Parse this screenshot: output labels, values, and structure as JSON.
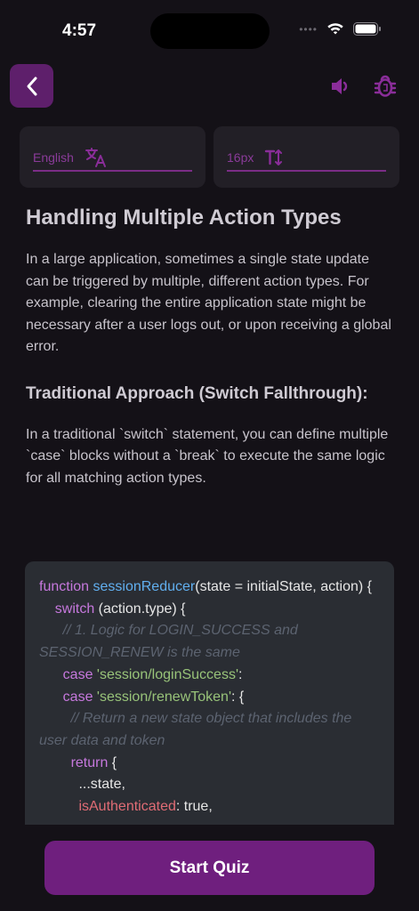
{
  "status": {
    "time": "4:57"
  },
  "colors": {
    "accent": "#6f1f7e",
    "background": "#141117",
    "code_bg": "#2a2d33"
  },
  "icons": {
    "back": "chevron-left-icon",
    "speaker": "speaker-icon",
    "bug": "bug-icon",
    "translate": "translate-icon",
    "font_size": "text-size-icon"
  },
  "settings": {
    "language": "English",
    "font_size": "16px"
  },
  "article": {
    "title": "Handling Multiple Action Types",
    "intro": "In a large application, sometimes a single state update can be triggered by multiple, different action types. For example, clearing the entire application state might be necessary after a user logs out, or upon receiving a global error.",
    "section_title": "Traditional Approach (Switch Fallthrough):",
    "section_text": "In a traditional `switch` statement, you can define multiple `case` blocks without a `break` to execute the same logic for all matching action types."
  },
  "code": {
    "l1_kw": "function",
    "l1_fn": "sessionReducer",
    "l1_rest": "(state = initialState, action) {",
    "l2_kw": "switch",
    "l2_rest": " (action.type) {",
    "l3_cm": "// 1. Logic for LOGIN_SUCCESS and SESSION_RENEW is the same",
    "l4_kw": "case",
    "l4_str": "'session/loginSuccess'",
    "l4_rest": ":",
    "l5_kw": "case",
    "l5_str": "'session/renewToken'",
    "l5_rest": ": {",
    "l6_cm": "// Return a new state object that includes the user data and token",
    "l7_kw": "return",
    "l7_rest": " {",
    "l8": "...state,",
    "l9_prop": "isAuthenticated",
    "l9_rest": ": true,"
  },
  "quiz": {
    "button_label": "Start Quiz"
  }
}
